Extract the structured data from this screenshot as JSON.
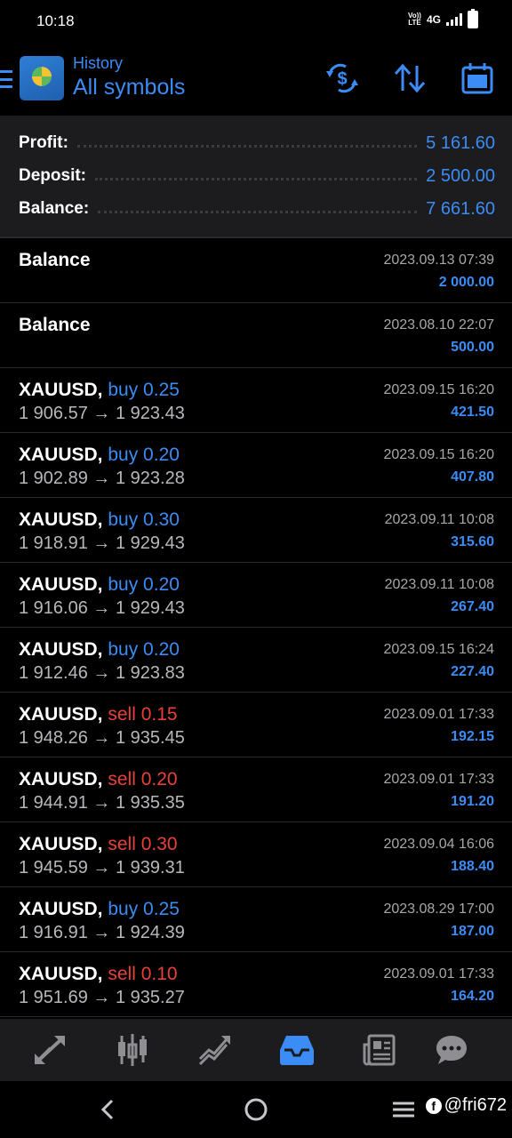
{
  "status_bar": {
    "time": "10:18",
    "volte": "VoLTE",
    "network": "4G"
  },
  "header": {
    "subtitle": "History",
    "title": "All symbols"
  },
  "summary": [
    {
      "label": "Profit:",
      "value": "5 161.60"
    },
    {
      "label": "Deposit:",
      "value": "2 500.00"
    },
    {
      "label": "Balance:",
      "value": "7 661.60"
    }
  ],
  "entries": [
    {
      "symbol": "Balance",
      "date": "2023.09.13 07:39",
      "profit": "2 000.00"
    },
    {
      "symbol": "Balance",
      "date": "2023.08.10 22:07",
      "profit": "500.00"
    },
    {
      "symbol": "XAUUSD,",
      "type": "buy 0.25",
      "prices": "1 906.57 → 1 923.43",
      "date": "2023.09.15 16:20",
      "profit": "421.50"
    },
    {
      "symbol": "XAUUSD,",
      "type": "buy 0.20",
      "prices": "1 902.89 → 1 923.28",
      "date": "2023.09.15 16:20",
      "profit": "407.80"
    },
    {
      "symbol": "XAUUSD,",
      "type": "buy 0.30",
      "prices": "1 918.91 → 1 929.43",
      "date": "2023.09.11 10:08",
      "profit": "315.60"
    },
    {
      "symbol": "XAUUSD,",
      "type": "buy 0.20",
      "prices": "1 916.06 → 1 929.43",
      "date": "2023.09.11 10:08",
      "profit": "267.40"
    },
    {
      "symbol": "XAUUSD,",
      "type": "buy 0.20",
      "prices": "1 912.46 → 1 923.83",
      "date": "2023.09.15 16:24",
      "profit": "227.40"
    },
    {
      "symbol": "XAUUSD,",
      "type": "sell 0.15",
      "prices": "1 948.26 → 1 935.45",
      "date": "2023.09.01 17:33",
      "profit": "192.15"
    },
    {
      "symbol": "XAUUSD,",
      "type": "sell 0.20",
      "prices": "1 944.91 → 1 935.35",
      "date": "2023.09.01 17:33",
      "profit": "191.20"
    },
    {
      "symbol": "XAUUSD,",
      "type": "sell 0.30",
      "prices": "1 945.59 → 1 939.31",
      "date": "2023.09.04 16:06",
      "profit": "188.40"
    },
    {
      "symbol": "XAUUSD,",
      "type": "buy 0.25",
      "prices": "1 916.91 → 1 924.39",
      "date": "2023.08.29 17:00",
      "profit": "187.00"
    },
    {
      "symbol": "XAUUSD,",
      "type": "sell 0.10",
      "prices": "1 951.69 → 1 935.27",
      "date": "2023.09.01 17:33",
      "profit": "164.20"
    }
  ],
  "bottom_nav": [
    {
      "icon": "quotes-icon",
      "active": false
    },
    {
      "icon": "chart-icon",
      "active": false
    },
    {
      "icon": "trade-icon",
      "active": false
    },
    {
      "icon": "history-icon",
      "active": true
    },
    {
      "icon": "news-icon",
      "active": false
    },
    {
      "icon": "messages-icon",
      "active": false
    }
  ],
  "watermark": "@fri672",
  "colors": {
    "accent": "#3b8cf5",
    "sell": "#e8413a",
    "background": "#000000",
    "panel": "#1c1c1e"
  }
}
